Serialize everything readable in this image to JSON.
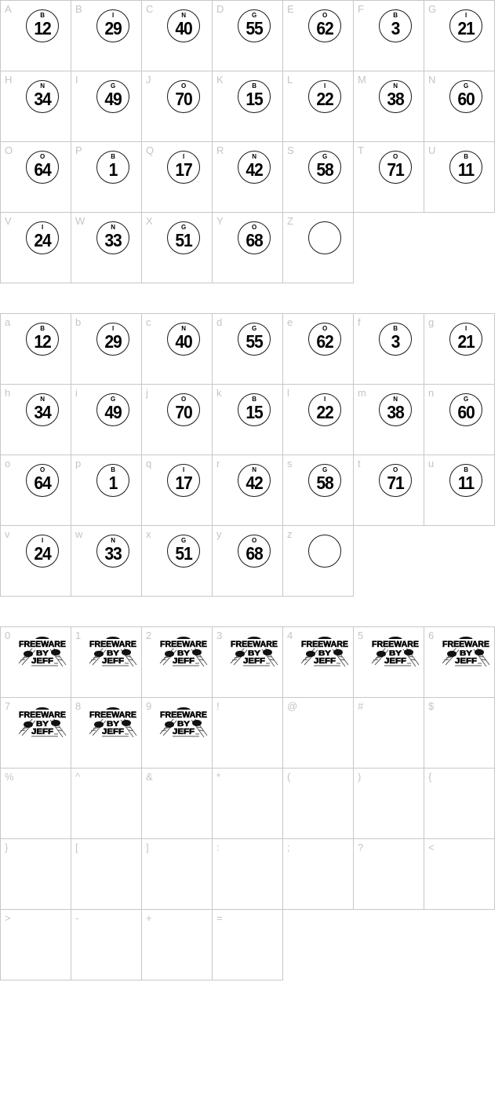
{
  "document": {
    "kind": "font-character-map",
    "background_color": "#ffffff",
    "grid_line_color": "#c8c8c8",
    "label_color": "#c4c4c4",
    "glyph_color": "#000000"
  },
  "sections": [
    {
      "name": "uppercase",
      "columns": 7,
      "cells": [
        {
          "label": "A",
          "glyph": "ball",
          "ball_letter": "B",
          "ball_number": "12"
        },
        {
          "label": "B",
          "glyph": "ball",
          "ball_letter": "I",
          "ball_number": "29"
        },
        {
          "label": "C",
          "glyph": "ball",
          "ball_letter": "N",
          "ball_number": "40"
        },
        {
          "label": "D",
          "glyph": "ball",
          "ball_letter": "G",
          "ball_number": "55"
        },
        {
          "label": "E",
          "glyph": "ball",
          "ball_letter": "O",
          "ball_number": "62"
        },
        {
          "label": "F",
          "glyph": "ball",
          "ball_letter": "B",
          "ball_number": "3"
        },
        {
          "label": "G",
          "glyph": "ball",
          "ball_letter": "I",
          "ball_number": "21"
        },
        {
          "label": "H",
          "glyph": "ball",
          "ball_letter": "N",
          "ball_number": "34"
        },
        {
          "label": "I",
          "glyph": "ball",
          "ball_letter": "G",
          "ball_number": "49"
        },
        {
          "label": "J",
          "glyph": "ball",
          "ball_letter": "O",
          "ball_number": "70"
        },
        {
          "label": "K",
          "glyph": "ball",
          "ball_letter": "B",
          "ball_number": "15"
        },
        {
          "label": "L",
          "glyph": "ball",
          "ball_letter": "I",
          "ball_number": "22"
        },
        {
          "label": "M",
          "glyph": "ball",
          "ball_letter": "N",
          "ball_number": "38"
        },
        {
          "label": "N",
          "glyph": "ball",
          "ball_letter": "G",
          "ball_number": "60"
        },
        {
          "label": "O",
          "glyph": "ball",
          "ball_letter": "O",
          "ball_number": "64"
        },
        {
          "label": "P",
          "glyph": "ball",
          "ball_letter": "B",
          "ball_number": "1"
        },
        {
          "label": "Q",
          "glyph": "ball",
          "ball_letter": "I",
          "ball_number": "17"
        },
        {
          "label": "R",
          "glyph": "ball",
          "ball_letter": "N",
          "ball_number": "42"
        },
        {
          "label": "S",
          "glyph": "ball",
          "ball_letter": "G",
          "ball_number": "58"
        },
        {
          "label": "T",
          "glyph": "ball",
          "ball_letter": "O",
          "ball_number": "71"
        },
        {
          "label": "U",
          "glyph": "ball",
          "ball_letter": "B",
          "ball_number": "11"
        },
        {
          "label": "V",
          "glyph": "ball",
          "ball_letter": "I",
          "ball_number": "24"
        },
        {
          "label": "W",
          "glyph": "ball",
          "ball_letter": "N",
          "ball_number": "33"
        },
        {
          "label": "X",
          "glyph": "ball",
          "ball_letter": "G",
          "ball_number": "51"
        },
        {
          "label": "Y",
          "glyph": "ball",
          "ball_letter": "O",
          "ball_number": "68"
        },
        {
          "label": "Z",
          "glyph": "ball-blank",
          "ball_letter": "",
          "ball_number": ""
        }
      ]
    },
    {
      "name": "lowercase",
      "columns": 7,
      "cells": [
        {
          "label": "a",
          "glyph": "ball",
          "ball_letter": "B",
          "ball_number": "12"
        },
        {
          "label": "b",
          "glyph": "ball",
          "ball_letter": "I",
          "ball_number": "29"
        },
        {
          "label": "c",
          "glyph": "ball",
          "ball_letter": "N",
          "ball_number": "40"
        },
        {
          "label": "d",
          "glyph": "ball",
          "ball_letter": "G",
          "ball_number": "55"
        },
        {
          "label": "e",
          "glyph": "ball",
          "ball_letter": "O",
          "ball_number": "62"
        },
        {
          "label": "f",
          "glyph": "ball",
          "ball_letter": "B",
          "ball_number": "3"
        },
        {
          "label": "g",
          "glyph": "ball",
          "ball_letter": "I",
          "ball_number": "21"
        },
        {
          "label": "h",
          "glyph": "ball",
          "ball_letter": "N",
          "ball_number": "34"
        },
        {
          "label": "i",
          "glyph": "ball",
          "ball_letter": "G",
          "ball_number": "49"
        },
        {
          "label": "j",
          "glyph": "ball",
          "ball_letter": "O",
          "ball_number": "70"
        },
        {
          "label": "k",
          "glyph": "ball",
          "ball_letter": "B",
          "ball_number": "15"
        },
        {
          "label": "l",
          "glyph": "ball",
          "ball_letter": "I",
          "ball_number": "22"
        },
        {
          "label": "m",
          "glyph": "ball",
          "ball_letter": "N",
          "ball_number": "38"
        },
        {
          "label": "n",
          "glyph": "ball",
          "ball_letter": "G",
          "ball_number": "60"
        },
        {
          "label": "o",
          "glyph": "ball",
          "ball_letter": "O",
          "ball_number": "64"
        },
        {
          "label": "p",
          "glyph": "ball",
          "ball_letter": "B",
          "ball_number": "1"
        },
        {
          "label": "q",
          "glyph": "ball",
          "ball_letter": "I",
          "ball_number": "17"
        },
        {
          "label": "r",
          "glyph": "ball",
          "ball_letter": "N",
          "ball_number": "42"
        },
        {
          "label": "s",
          "glyph": "ball",
          "ball_letter": "G",
          "ball_number": "58"
        },
        {
          "label": "t",
          "glyph": "ball",
          "ball_letter": "O",
          "ball_number": "71"
        },
        {
          "label": "u",
          "glyph": "ball",
          "ball_letter": "B",
          "ball_number": "11"
        },
        {
          "label": "v",
          "glyph": "ball",
          "ball_letter": "I",
          "ball_number": "24"
        },
        {
          "label": "w",
          "glyph": "ball",
          "ball_letter": "N",
          "ball_number": "33"
        },
        {
          "label": "x",
          "glyph": "ball",
          "ball_letter": "G",
          "ball_number": "51"
        },
        {
          "label": "y",
          "glyph": "ball",
          "ball_letter": "O",
          "ball_number": "68"
        },
        {
          "label": "z",
          "glyph": "ball-blank",
          "ball_letter": "",
          "ball_number": ""
        }
      ]
    },
    {
      "name": "digits-and-symbols",
      "columns": 7,
      "logo_text": {
        "line1": "FREEWARE",
        "line2": "BY",
        "line3": "JEFF"
      },
      "cells": [
        {
          "label": "0",
          "glyph": "logo"
        },
        {
          "label": "1",
          "glyph": "logo"
        },
        {
          "label": "2",
          "glyph": "logo"
        },
        {
          "label": "3",
          "glyph": "logo"
        },
        {
          "label": "4",
          "glyph": "logo"
        },
        {
          "label": "5",
          "glyph": "logo"
        },
        {
          "label": "6",
          "glyph": "logo"
        },
        {
          "label": "7",
          "glyph": "logo"
        },
        {
          "label": "8",
          "glyph": "logo"
        },
        {
          "label": "9",
          "glyph": "logo"
        },
        {
          "label": "!",
          "glyph": "none"
        },
        {
          "label": "@",
          "glyph": "none"
        },
        {
          "label": "#",
          "glyph": "none"
        },
        {
          "label": "$",
          "glyph": "none"
        },
        {
          "label": "%",
          "glyph": "none"
        },
        {
          "label": "^",
          "glyph": "none"
        },
        {
          "label": "&",
          "glyph": "none"
        },
        {
          "label": "*",
          "glyph": "none"
        },
        {
          "label": "(",
          "glyph": "none"
        },
        {
          "label": ")",
          "glyph": "none"
        },
        {
          "label": "{",
          "glyph": "none"
        },
        {
          "label": "}",
          "glyph": "none"
        },
        {
          "label": "[",
          "glyph": "none"
        },
        {
          "label": "]",
          "glyph": "none"
        },
        {
          "label": ":",
          "glyph": "none"
        },
        {
          "label": ";",
          "glyph": "none"
        },
        {
          "label": "?",
          "glyph": "none"
        },
        {
          "label": "<",
          "glyph": "none"
        },
        {
          "label": ">",
          "glyph": "none"
        },
        {
          "label": "-",
          "glyph": "none"
        },
        {
          "label": "+",
          "glyph": "none"
        },
        {
          "label": "=",
          "glyph": "none"
        }
      ]
    }
  ]
}
